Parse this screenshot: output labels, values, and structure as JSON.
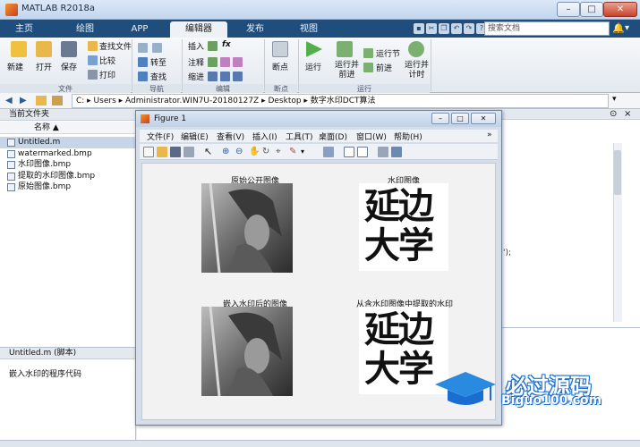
{
  "window": {
    "title": "MATLAB R2018a"
  },
  "tabs": [
    "主页",
    "绘图",
    "APP",
    "编辑器",
    "发布",
    "视图"
  ],
  "search": {
    "placeholder": "搜索文档"
  },
  "ribbon": {
    "file": {
      "new": "新建",
      "open": "打开",
      "save": "保存",
      "find_files": "查找文件",
      "compare": "比较",
      "print": "打印"
    },
    "navigate": {
      "goto": "转至",
      "find": "查找"
    },
    "edit": {
      "insert": "插入",
      "comment": "注释",
      "indent": "缩进"
    },
    "breakpoints": {
      "breakpoint": "断点"
    },
    "run": {
      "run": "运行",
      "run_advance": "运行并\n前进",
      "run_section": "运行节",
      "advance": "前进",
      "run_time": "运行并\n计时"
    },
    "sections": {
      "file": "文件",
      "navigate": "导航",
      "edit": "编辑",
      "breakpoints": "断点",
      "run": "运行"
    }
  },
  "address": {
    "path": "C:  ▸  Users  ▸  Administrator.WIN7U-20180127Z  ▸  Desktop  ▸  数字水印DCT算法"
  },
  "left_panel": {
    "header": "当前文件夹",
    "column": "名称 ▲",
    "files": [
      "Untitled.m",
      "watermarked.bmp",
      "水印图像.bmp",
      "提取的水印图像.bmp",
      "原始图像.bmp"
    ],
    "detail_title": "Untitled.m  (脚本)",
    "detail_text": "嵌入水印的程序代码"
  },
  "editor": {
    "fragment": "');"
  },
  "figure": {
    "title": "Figure 1",
    "menus": [
      "文件(F)",
      "编辑(E)",
      "查看(V)",
      "插入(I)",
      "工具(T)",
      "桌面(D)",
      "窗口(W)",
      "帮助(H)"
    ],
    "plots": [
      {
        "title": "原始公开图像"
      },
      {
        "title": "水印图像",
        "watermark_text": [
          "延边",
          "大学"
        ]
      },
      {
        "title": "嵌入水印后的图像"
      },
      {
        "title": "从含水印图像中提取的水印",
        "watermark_text": [
          "延边",
          "大学"
        ]
      }
    ]
  },
  "watermark_logo": {
    "brand": "必过源码",
    "url": "Biguo100.com"
  }
}
